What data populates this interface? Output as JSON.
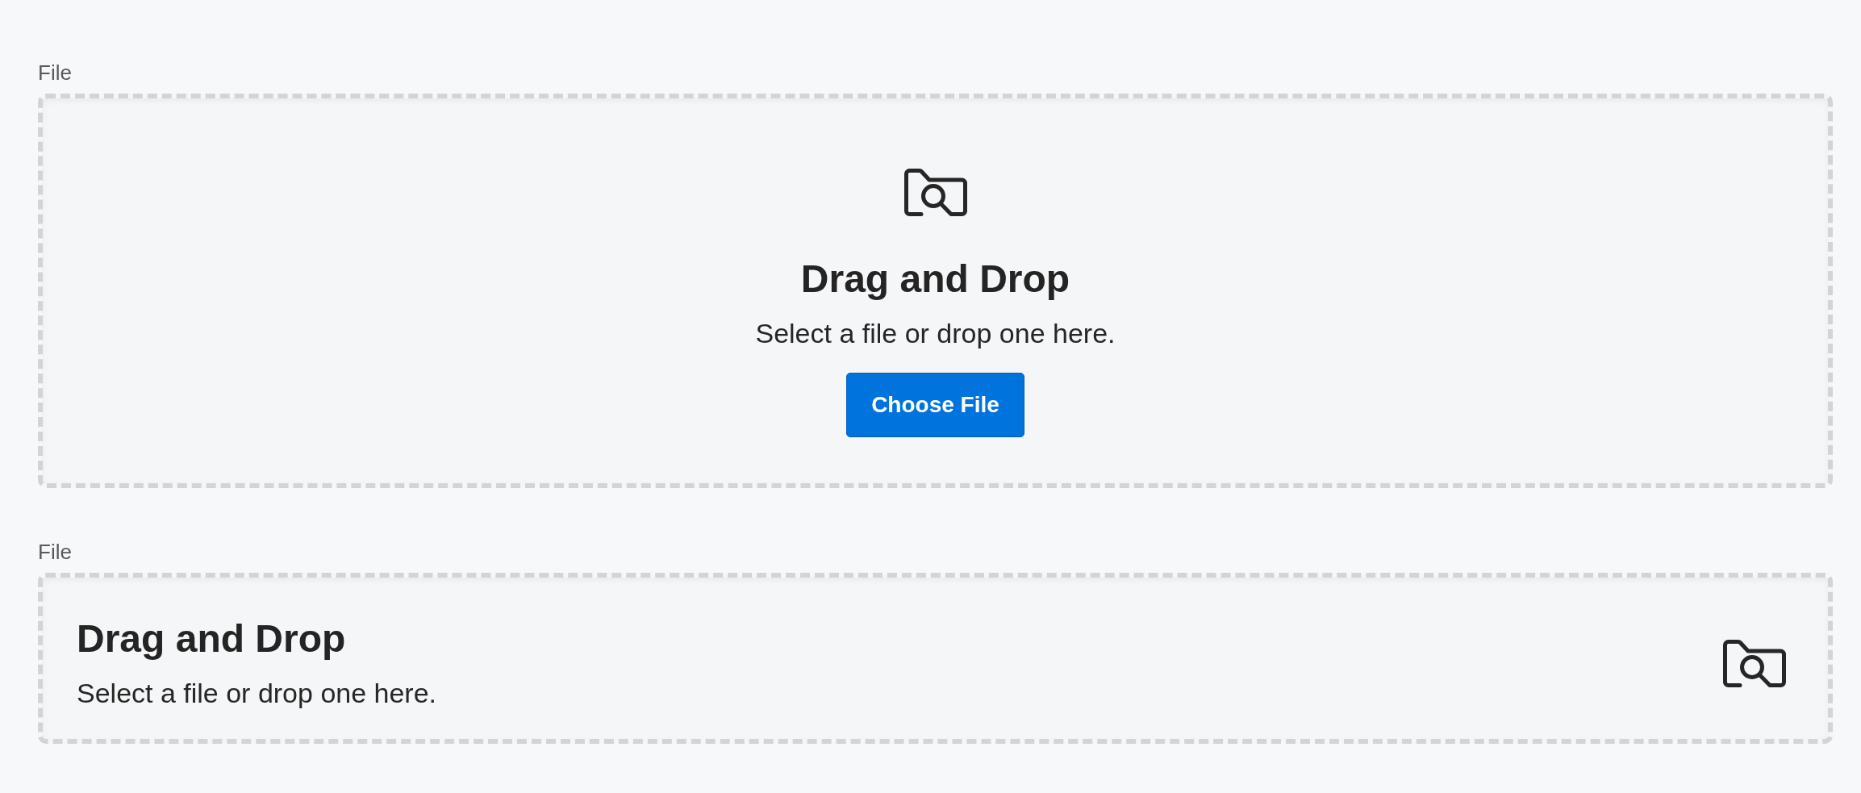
{
  "uploaders": [
    {
      "kind": "stacked",
      "label": "File",
      "heading": "Drag and Drop",
      "message": "Select a file or drop one here.",
      "button": "Choose File"
    },
    {
      "kind": "inline",
      "label": "File",
      "heading": "Drag and Drop",
      "message": "Select a file or drop one here."
    }
  ]
}
